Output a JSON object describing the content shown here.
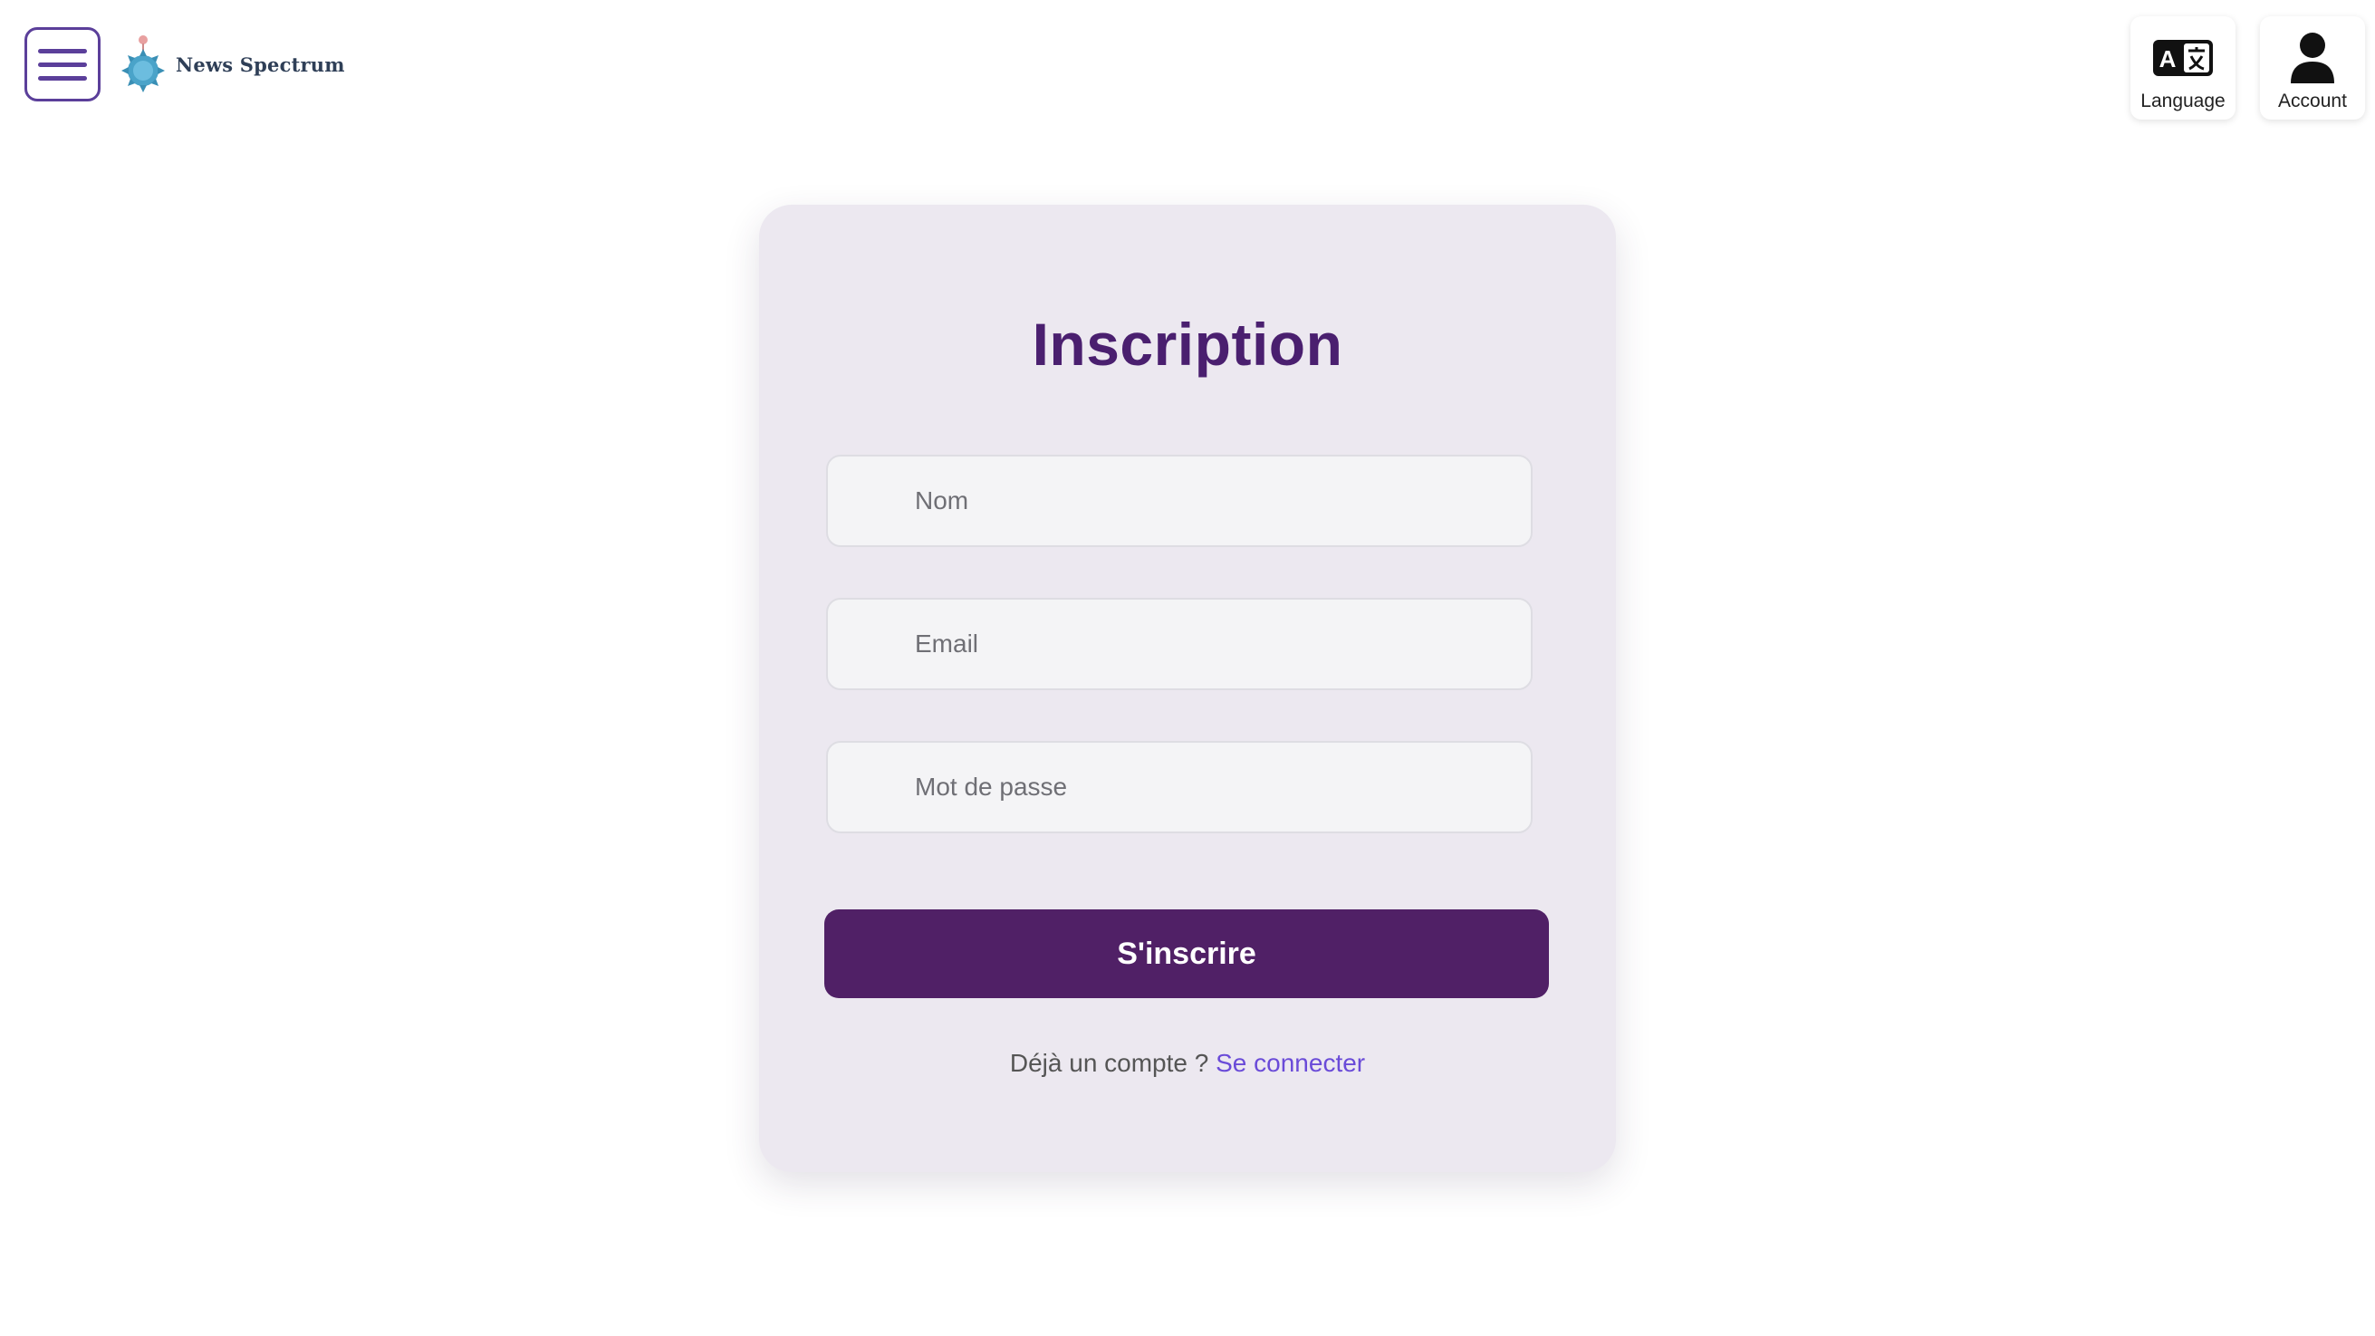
{
  "header": {
    "menu_icon": "hamburger-menu-icon",
    "brand_name": "News Spectrum",
    "brand_logo_icon": "globe-logo-icon",
    "language_label": "Language",
    "language_icon": "translate-icon",
    "account_label": "Account",
    "account_icon": "user-icon"
  },
  "form": {
    "title": "Inscription",
    "name_placeholder": "Nom",
    "email_placeholder": "Email",
    "password_placeholder": "Mot de passe",
    "submit_label": "S'inscrire",
    "login_prompt": "Déjà un compte ?",
    "login_link": "Se connecter"
  },
  "colors": {
    "accent": "#502066",
    "title": "#4a1f6f",
    "link": "#6a4bd8",
    "card_bg": "#ece8f0",
    "menu_border": "#5b3f9a"
  }
}
